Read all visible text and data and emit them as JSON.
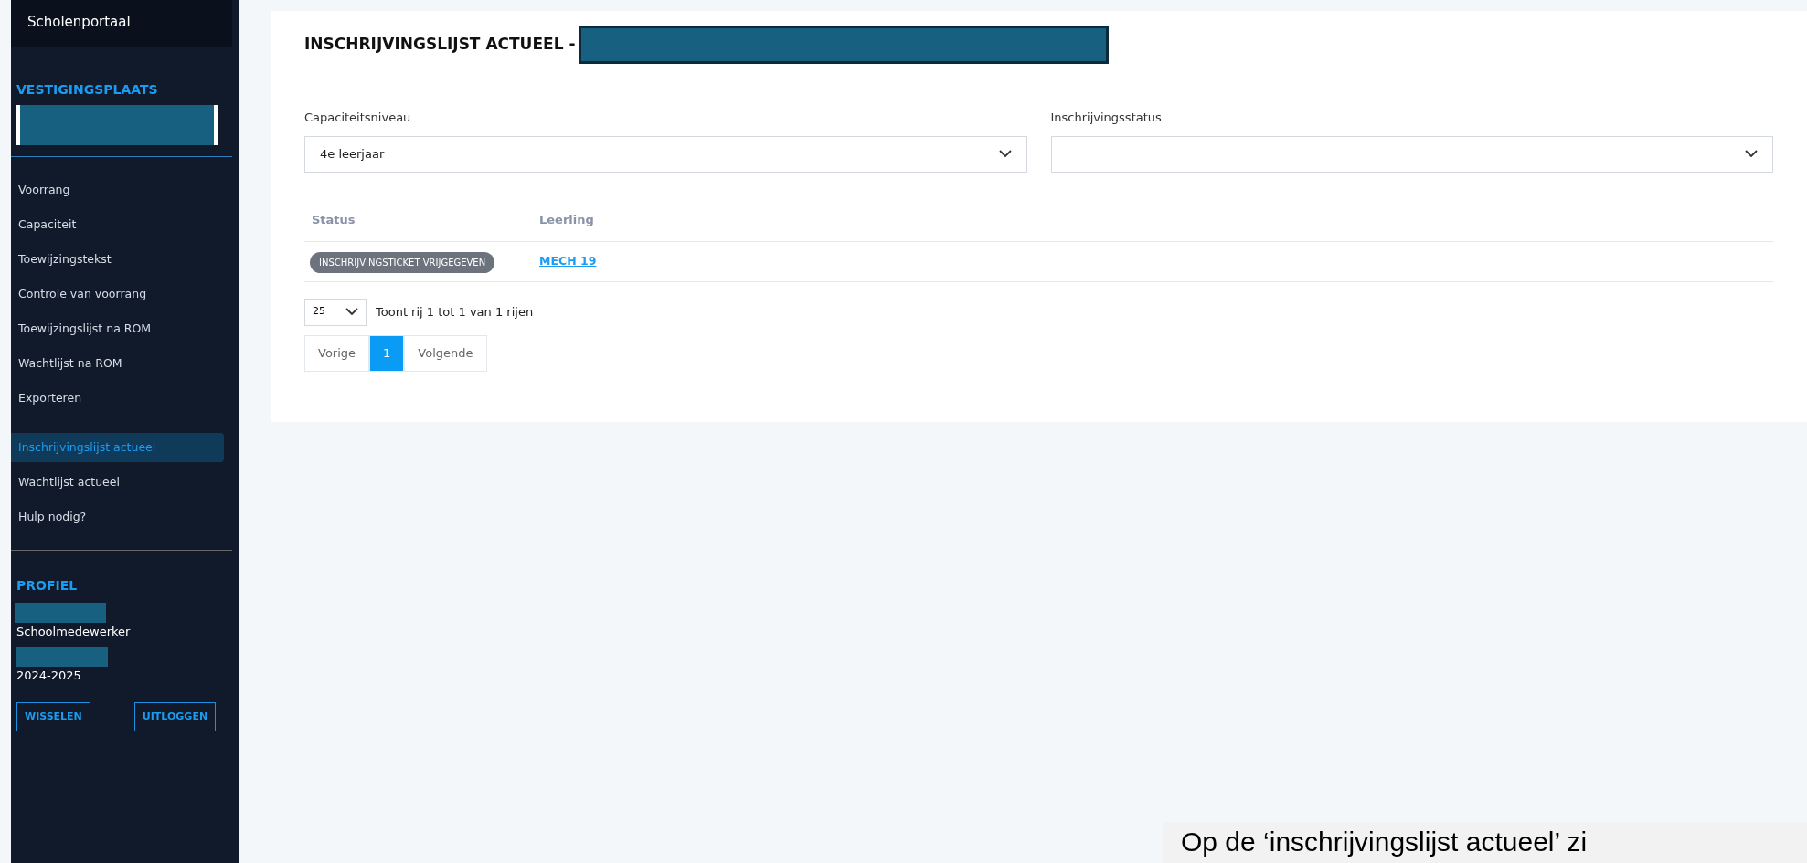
{
  "sidebar": {
    "brand": "Scholenportaal",
    "section_title": "VESTIGINGSPLAATS",
    "menu_groups": [
      {
        "items": [
          {
            "label": "Voorrang",
            "selected": false
          },
          {
            "label": "Capaciteit",
            "selected": false
          },
          {
            "label": "Toewijzingstekst",
            "selected": false
          },
          {
            "label": "Controle van voorrang",
            "selected": false
          },
          {
            "label": "Toewijzingslijst na ROM",
            "selected": false
          },
          {
            "label": "Wachtlijst na ROM",
            "selected": false
          },
          {
            "label": "Exporteren",
            "selected": false
          }
        ]
      },
      {
        "items": [
          {
            "label": "Inschrijvingslijst actueel",
            "selected": true
          },
          {
            "label": "Wachtlijst actueel",
            "selected": false
          },
          {
            "label": "Hulp nodig?",
            "selected": false
          }
        ]
      }
    ],
    "profile": {
      "title": "PROFIEL",
      "role": "Schoolmedewerker",
      "year": "2024-2025",
      "buttons": [
        "WISSELEN",
        "UITLOGGEN"
      ]
    }
  },
  "main": {
    "title": "INSCHRIJVINGSLIJST ACTUEEL -",
    "filters": [
      {
        "label": "Capaciteitsniveau",
        "value": "4e leerjaar"
      },
      {
        "label": "Inschrijvingsstatus"
      }
    ],
    "table": {
      "columns": [
        "Status",
        "Leerling"
      ],
      "rows": [
        {
          "status": "INSCHRIJVINGSTICKET VRIJGEGEVEN",
          "student": "MECH 19"
        }
      ]
    },
    "page_size": "25",
    "summary": "Toont rij 1 tot 1 van 1 rijen",
    "pagination": [
      {
        "label": "Vorige",
        "selected": false
      },
      {
        "label": "1",
        "selected": true
      },
      {
        "label": "Volgende",
        "selected": false
      }
    ]
  },
  "caption": "Op de ‘inschrijvingslijst actueel’ zi"
}
